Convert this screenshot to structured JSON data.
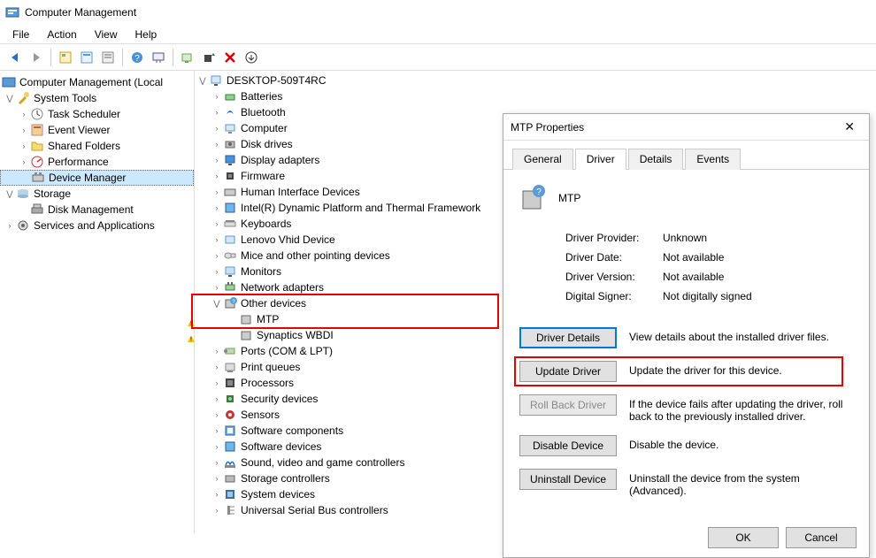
{
  "window": {
    "title": "Computer Management"
  },
  "menu": {
    "items": [
      "File",
      "Action",
      "View",
      "Help"
    ]
  },
  "leftTree": {
    "root": "Computer Management (Local",
    "systemTools": {
      "label": "System Tools",
      "children": [
        "Task Scheduler",
        "Event Viewer",
        "Shared Folders",
        "Performance",
        "Device Manager"
      ]
    },
    "storage": {
      "label": "Storage",
      "children": [
        "Disk Management"
      ]
    },
    "services": {
      "label": "Services and Applications"
    }
  },
  "devTree": {
    "root": "DESKTOP-509T4RC",
    "items": [
      "Batteries",
      "Bluetooth",
      "Computer",
      "Disk drives",
      "Display adapters",
      "Firmware",
      "Human Interface Devices",
      "Intel(R) Dynamic Platform and Thermal Framework",
      "Keyboards",
      "Lenovo Vhid Device",
      "Mice and other pointing devices",
      "Monitors",
      "Network adapters"
    ],
    "other": {
      "label": "Other devices",
      "children": [
        "MTP",
        "Synaptics WBDI"
      ]
    },
    "items2": [
      "Ports (COM & LPT)",
      "Print queues",
      "Processors",
      "Security devices",
      "Sensors",
      "Software components",
      "Software devices",
      "Sound, video and game controllers",
      "Storage controllers",
      "System devices",
      "Universal Serial Bus controllers"
    ]
  },
  "dialog": {
    "title": "MTP Properties",
    "tabs": [
      "General",
      "Driver",
      "Details",
      "Events"
    ],
    "deviceName": "MTP",
    "info": {
      "provider_l": "Driver Provider:",
      "provider_v": "Unknown",
      "date_l": "Driver Date:",
      "date_v": "Not available",
      "version_l": "Driver Version:",
      "version_v": "Not available",
      "signer_l": "Digital Signer:",
      "signer_v": "Not digitally signed"
    },
    "buttons": {
      "details": "Driver Details",
      "details_d": "View details about the installed driver files.",
      "update": "Update Driver",
      "update_d": "Update the driver for this device.",
      "rollback": "Roll Back Driver",
      "rollback_d": "If the device fails after updating the driver, roll back to the previously installed driver.",
      "disable": "Disable Device",
      "disable_d": "Disable the device.",
      "uninstall": "Uninstall Device",
      "uninstall_d": "Uninstall the device from the system (Advanced)."
    },
    "ok": "OK",
    "cancel": "Cancel"
  }
}
